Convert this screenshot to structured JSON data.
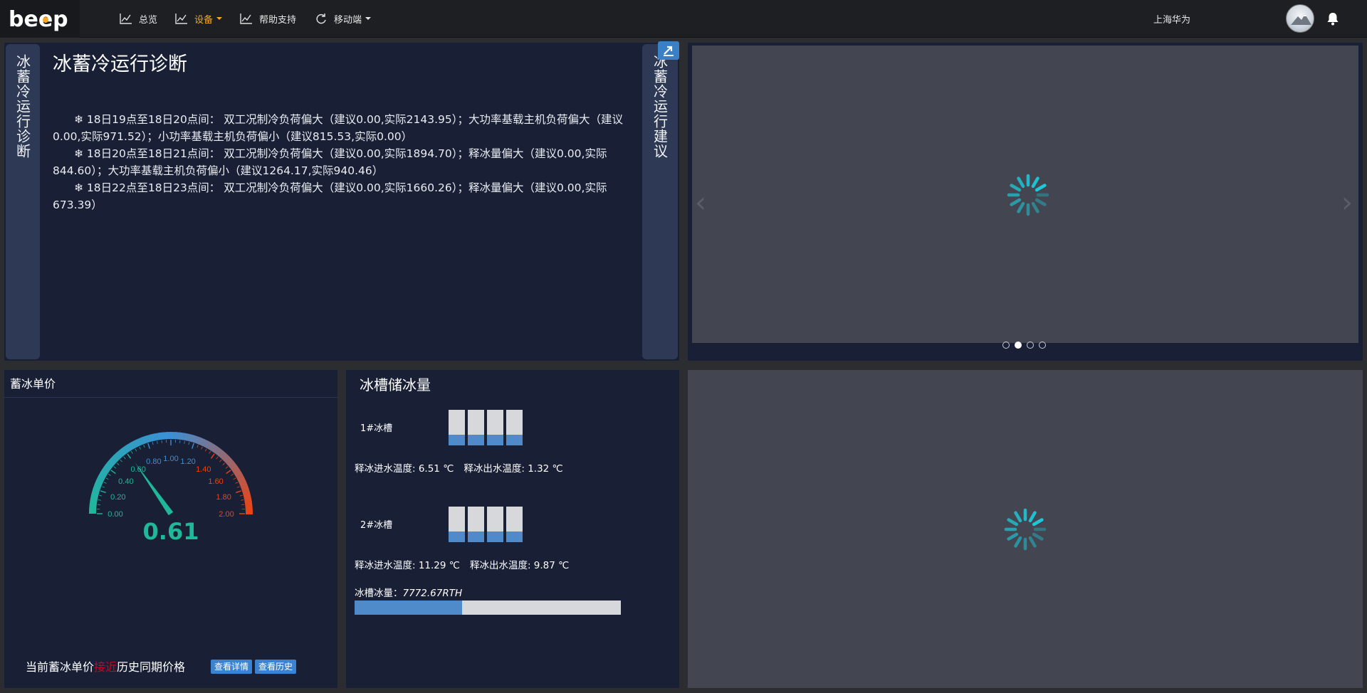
{
  "topbar": {
    "logo_text": "beep",
    "nav": [
      {
        "label": "总览",
        "icon": "line-chart-icon",
        "has_caret": false
      },
      {
        "label": "设备",
        "icon": "line-chart-icon",
        "has_caret": true,
        "active": true
      },
      {
        "label": "帮助支持",
        "icon": "line-chart-icon",
        "has_caret": false
      },
      {
        "label": "移动端",
        "icon": "refresh-icon",
        "has_caret": true
      }
    ],
    "user_name": "上海华为",
    "accent_color": "#f5a623"
  },
  "diagnosis": {
    "left_tab": "冰蓄冷运行诊断",
    "right_tab": "冰蓄冷运行建议",
    "title": "冰蓄冷运行诊断",
    "lines": [
      "❄ 18日19点至18日20点间： 双工况制冷负荷偏大（建议0.00,实际2143.95）；大功率基载主机负荷偏大（建议0.00,实际971.52）；小功率基载主机负荷偏小（建议815.53,实际0.00）",
      "❄ 18日20点至18日21点间： 双工况制冷负荷偏大（建议0.00,实际1894.70）；释冰量偏大（建议0.00,实际844.60）；大功率基载主机负荷偏小（建议1264.17,实际940.46）",
      "❄ 18日22点至18日23点间： 双工况制冷负荷偏大（建议0.00,实际1660.26）；释冰量偏大（建议0.00,实际673.39）"
    ]
  },
  "carousel": {
    "prev": "‹",
    "next": "›",
    "dots": 4,
    "active_dot": 1,
    "spinner_color": "#1ec8d8"
  },
  "ice_price": {
    "title": "蓄冰单价",
    "gauge": {
      "min": 0,
      "max": 2,
      "ticks": [
        "0.00",
        "0.20",
        "0.40",
        "0.60",
        "0.80",
        "1.00",
        "1.20",
        "1.40",
        "1.60",
        "1.80",
        "2.00"
      ],
      "value": 0.61,
      "value_label": "0.61",
      "low_color": "#1fb89a",
      "mid_color": "#3b8fd6",
      "high_color": "#f0420f"
    },
    "note_prefix": "当前蓄冰单价",
    "note_highlight": "接近",
    "note_suffix": "历史同期价格",
    "detail_button": "查看详情",
    "history_button": "查看历史"
  },
  "ice_storage": {
    "title": "冰槽储冰量",
    "tanks": [
      {
        "label": "1#冰槽",
        "levels": [
          0.3,
          0.3,
          0.3,
          0.3
        ],
        "in_temp": "释冰进水温度: 6.51 ℃",
        "out_temp": "释冰出水温度: 1.32 ℃"
      },
      {
        "label": "2#冰槽",
        "levels": [
          0.3,
          0.3,
          0.3,
          0.3
        ],
        "in_temp": "释冰进水温度: 11.29 ℃",
        "out_temp": "释冰出水温度: 9.87 ℃"
      }
    ],
    "capacity_label": "冰槽冰量：",
    "capacity_value": "7772.67RTH",
    "capacity_fraction": 0.405
  }
}
